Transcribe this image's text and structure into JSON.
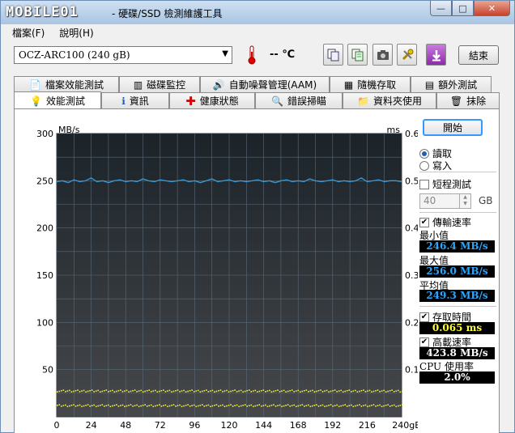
{
  "window": {
    "logo": "MOBILE01",
    "title": "- 硬碟/SSD 檢測維護工具",
    "min": "—",
    "max": "□",
    "close": "✕"
  },
  "menu": {
    "file": "檔案(F)",
    "help": "說明(H)"
  },
  "toolbar": {
    "drive": "OCZ-ARC100 (240 gB)",
    "temperature": "-- ℃",
    "exit_label": "結束",
    "icons": [
      "copy-icon",
      "copy-text-icon",
      "camera-icon",
      "tools-icon",
      "save-icon"
    ]
  },
  "tabs_row1": [
    "檔案效能測試",
    "磁碟監控",
    "自動噪聲管理(AAM)",
    "隨機存取",
    "額外測試"
  ],
  "tabs_row2": [
    "效能測試",
    "資訊",
    "健康狀態",
    "錯誤掃瞄",
    "資料夾使用",
    "抹除"
  ],
  "controls": {
    "start_label": "開始",
    "read_label": "讀取",
    "write_label": "寫入",
    "short_test_label": "短程測試",
    "short_test_value": "40",
    "short_test_unit": "GB",
    "transfer_rate_label": "傳輸速率",
    "min_label": "最小值",
    "min_value": "246.4 MB/s",
    "max_label": "最大值",
    "max_value": "256.0 MB/s",
    "avg_label": "平均值",
    "avg_value": "249.3 MB/s",
    "access_time_label": "存取時間",
    "access_time_value": "0.065 ms",
    "burst_label": "高載速率",
    "burst_value": "423.8 MB/s",
    "cpu_label": "CPU 使用率",
    "cpu_value": "2.0%"
  },
  "chart_data": {
    "type": "line",
    "left_unit": "MB/s",
    "right_unit": "ms",
    "x_ticks": [
      "0",
      "24",
      "48",
      "72",
      "96",
      "120",
      "144",
      "168",
      "192",
      "216",
      "240gB"
    ],
    "y_left_ticks": [
      "300",
      "250",
      "200",
      "150",
      "100",
      "50"
    ],
    "y_right_ticks": [
      "0.60",
      "0.50",
      "0.40",
      "0.30",
      "0.20",
      "0.10"
    ],
    "xlim": [
      0,
      240
    ],
    "ylim_left": [
      0,
      300
    ],
    "ylim_right": [
      0,
      0.6
    ],
    "grid": true,
    "series": [
      {
        "axis": "left",
        "values_mbps": [
          249,
          250,
          248,
          251,
          249,
          250,
          253,
          249,
          250,
          248,
          250,
          251,
          249,
          250,
          249,
          252,
          250,
          249,
          251,
          250,
          249,
          250,
          251,
          249,
          250,
          248,
          250,
          252,
          249,
          250,
          251,
          249,
          250,
          249,
          250,
          251,
          249,
          250,
          248,
          250,
          251,
          249,
          250,
          249,
          252,
          250,
          249,
          250,
          251,
          249,
          250,
          249,
          250,
          253,
          249,
          250,
          251,
          249,
          250,
          250,
          249
        ]
      },
      {
        "axis": "right",
        "access_time_bands_ms": [
          0.056,
          0.025
        ]
      }
    ]
  }
}
